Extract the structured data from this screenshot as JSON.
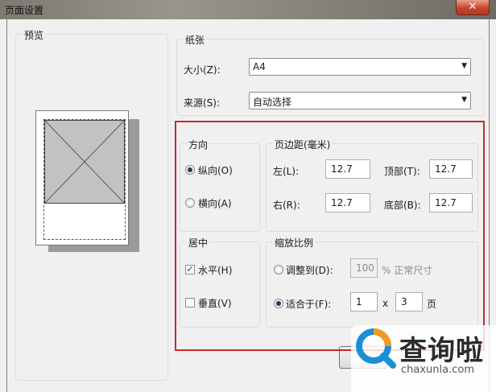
{
  "window": {
    "title": "页面设置",
    "close_glyph": "✕"
  },
  "preview": {
    "label": "预览"
  },
  "paper": {
    "label": "纸张",
    "size_label": "大小(Z):",
    "size_value": "A4",
    "source_label": "来源(S):",
    "source_value": "自动选择"
  },
  "orientation": {
    "label": "方向",
    "portrait": "纵向(O)",
    "landscape": "横向(A)",
    "selected": "portrait"
  },
  "margins": {
    "label": "页边距(毫米)",
    "left_label": "左(L):",
    "left_value": "12.7",
    "top_label": "顶部(T):",
    "top_value": "12.7",
    "right_label": "右(R):",
    "right_value": "12.7",
    "bottom_label": "底部(B):",
    "bottom_value": "12.7"
  },
  "center": {
    "label": "居中",
    "horizontal": "水平(H)",
    "horizontal_checked": true,
    "vertical": "垂直(V)",
    "vertical_checked": false
  },
  "scale": {
    "label": "缩放比例",
    "adjust_label": "调整到(D):",
    "adjust_value": "100",
    "adjust_suffix": "% 正常尺寸",
    "fit_label": "适合于(F):",
    "fit_wide": "1",
    "fit_x": "x",
    "fit_tall": "3",
    "fit_unit": "页",
    "selected": "fit"
  },
  "watermark": {
    "text": "查询啦",
    "url": "chaxunla.com"
  },
  "colors": {
    "highlight": "#c62a2a",
    "accent": "#1a8fd6",
    "accent2": "#f29a1e"
  }
}
